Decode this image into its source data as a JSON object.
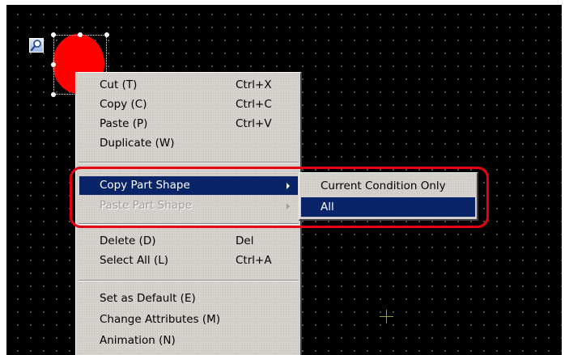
{
  "canvas": {
    "background": "#000000",
    "grid_dot_color": "#5a5a5a"
  },
  "part": {
    "icon": "search-magnifier-icon",
    "shape": "circle",
    "fill_color": "#ff0000"
  },
  "context_menu": {
    "items": [
      {
        "label": "Cut (T)",
        "shortcut": "Ctrl+X"
      },
      {
        "label": "Copy (C)",
        "shortcut": "Ctrl+C"
      },
      {
        "label": "Paste (P)",
        "shortcut": "Ctrl+V"
      },
      {
        "label": "Duplicate (W)",
        "shortcut": ""
      },
      {
        "label": "Copy Part Shape",
        "shortcut": "",
        "submenu": true,
        "highlighted": true
      },
      {
        "label": "Paste Part Shape",
        "shortcut": "",
        "submenu": true,
        "disabled": true
      },
      {
        "label": "Delete (D)",
        "shortcut": "Del"
      },
      {
        "label": "Select All (L)",
        "shortcut": "Ctrl+A"
      },
      {
        "label": "Set as Default (E)",
        "shortcut": ""
      },
      {
        "label": "Change Attributes (M)",
        "shortcut": ""
      },
      {
        "label": "Animation (N)",
        "shortcut": ""
      }
    ]
  },
  "submenu": {
    "items": [
      {
        "label": "Current Condition Only"
      },
      {
        "label": "All",
        "highlighted": true
      }
    ]
  },
  "colors": {
    "menu_bg": "#d6d3ce",
    "highlight_bg": "#0a246a",
    "callout_ring": "#e60012"
  }
}
